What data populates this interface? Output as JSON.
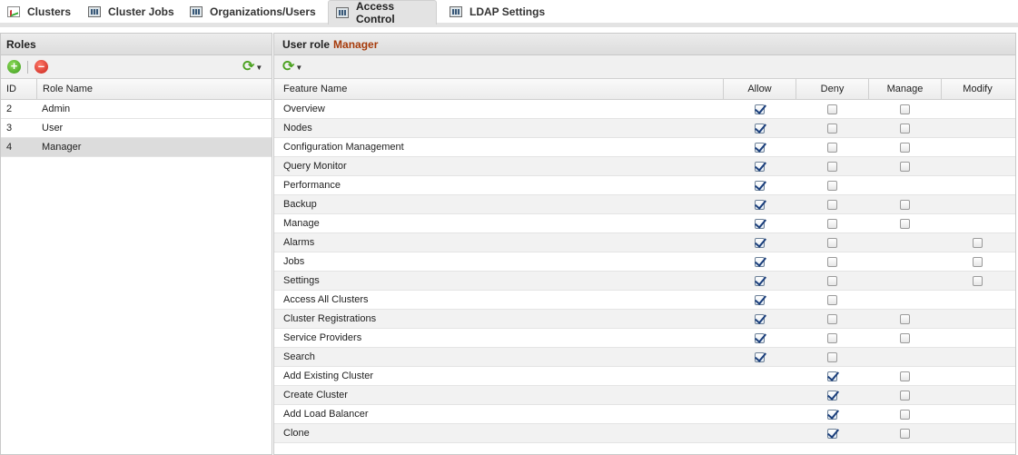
{
  "tabs": [
    {
      "label": "Clusters",
      "icon": "chart-icon",
      "active": false
    },
    {
      "label": "Cluster Jobs",
      "icon": "grid-icon",
      "active": false
    },
    {
      "label": "Organizations/Users",
      "icon": "grid-icon",
      "active": false
    },
    {
      "label": "Access Control",
      "icon": "grid-icon",
      "active": true
    },
    {
      "label": "LDAP Settings",
      "icon": "grid-icon",
      "active": false
    }
  ],
  "roles_panel": {
    "title": "Roles",
    "columns": {
      "id": "ID",
      "name": "Role Name"
    },
    "rows": [
      {
        "id": "2",
        "name": "Admin",
        "selected": false
      },
      {
        "id": "3",
        "name": "User",
        "selected": false
      },
      {
        "id": "4",
        "name": "Manager",
        "selected": true
      }
    ]
  },
  "features_panel": {
    "title_prefix": "User role",
    "title_role": "Manager",
    "accent_color": "#a63a0a",
    "columns": {
      "feature": "Feature Name",
      "allow": "Allow",
      "deny": "Deny",
      "manage": "Manage",
      "modify": "Modify"
    },
    "rows": [
      {
        "name": "Overview",
        "allow": true,
        "deny": false,
        "manage": false,
        "modify": null
      },
      {
        "name": "Nodes",
        "allow": true,
        "deny": false,
        "manage": false,
        "modify": null
      },
      {
        "name": "Configuration Management",
        "allow": true,
        "deny": false,
        "manage": false,
        "modify": null
      },
      {
        "name": "Query Monitor",
        "allow": true,
        "deny": false,
        "manage": false,
        "modify": null
      },
      {
        "name": "Performance",
        "allow": true,
        "deny": false,
        "manage": null,
        "modify": null
      },
      {
        "name": "Backup",
        "allow": true,
        "deny": false,
        "manage": false,
        "modify": null
      },
      {
        "name": "Manage",
        "allow": true,
        "deny": false,
        "manage": false,
        "modify": null
      },
      {
        "name": "Alarms",
        "allow": true,
        "deny": false,
        "manage": null,
        "modify": false
      },
      {
        "name": "Jobs",
        "allow": true,
        "deny": false,
        "manage": null,
        "modify": false
      },
      {
        "name": "Settings",
        "allow": true,
        "deny": false,
        "manage": null,
        "modify": false
      },
      {
        "name": "Access All Clusters",
        "allow": true,
        "deny": false,
        "manage": null,
        "modify": null
      },
      {
        "name": "Cluster Registrations",
        "allow": true,
        "deny": false,
        "manage": false,
        "modify": null
      },
      {
        "name": "Service Providers",
        "allow": true,
        "deny": false,
        "manage": false,
        "modify": null
      },
      {
        "name": "Search",
        "allow": true,
        "deny": false,
        "manage": null,
        "modify": null
      },
      {
        "name": "Add Existing Cluster",
        "allow": null,
        "deny": true,
        "manage": false,
        "modify": null
      },
      {
        "name": "Create Cluster",
        "allow": null,
        "deny": true,
        "manage": false,
        "modify": null
      },
      {
        "name": "Add Load Balancer",
        "allow": null,
        "deny": true,
        "manage": false,
        "modify": null
      },
      {
        "name": "Clone",
        "allow": null,
        "deny": true,
        "manage": false,
        "modify": null
      }
    ]
  }
}
